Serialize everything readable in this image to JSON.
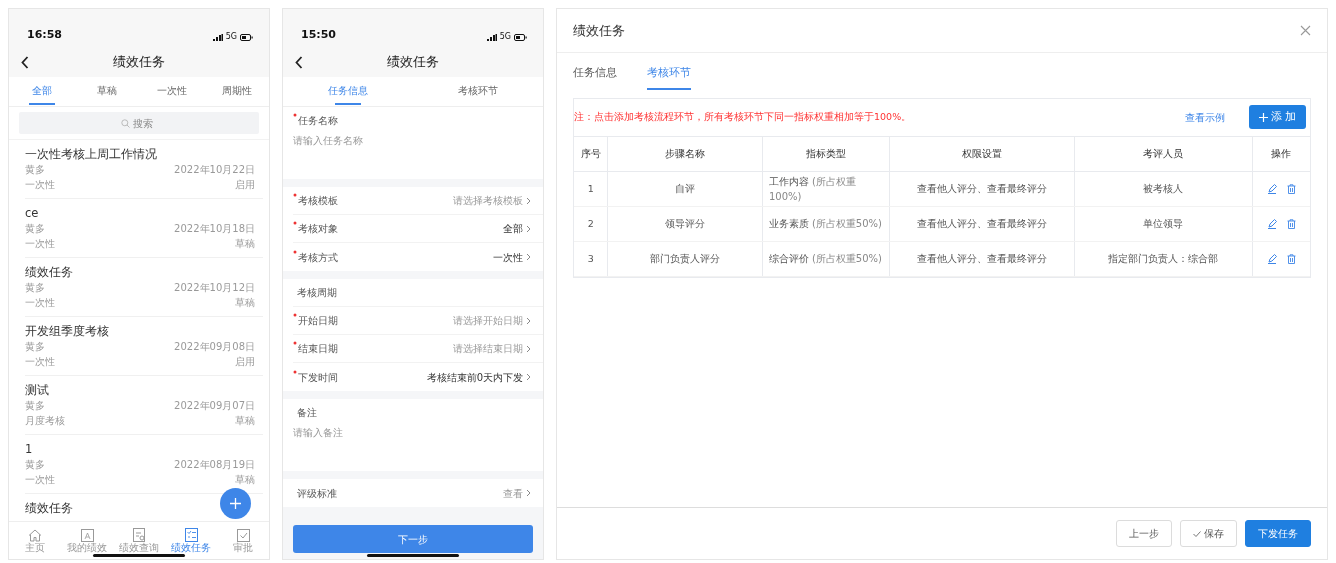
{
  "list_screen": {
    "status_time": "16:58",
    "network": "5G",
    "title": "绩效任务",
    "tabs": [
      {
        "label": "全部",
        "selected": true
      },
      {
        "label": "草稿",
        "selected": false
      },
      {
        "label": "一次性",
        "selected": false
      },
      {
        "label": "周期性",
        "selected": false
      }
    ],
    "search": {
      "placeholder": "搜索"
    },
    "items": [
      {
        "title": "一次性考核上周工作情况",
        "author": "黄多",
        "date": "2022年10月22日",
        "type": "一次性",
        "status": "启用"
      },
      {
        "title": "ce",
        "author": "黄多",
        "date": "2022年10月18日",
        "type": "一次性",
        "status": "草稿"
      },
      {
        "title": "绩效任务",
        "author": "黄多",
        "date": "2022年10月12日",
        "type": "一次性",
        "status": "草稿"
      },
      {
        "title": "开发组季度考核",
        "author": "黄多",
        "date": "2022年09月08日",
        "type": "一次性",
        "status": "启用"
      },
      {
        "title": "测试",
        "author": "黄多",
        "date": "2022年09月07日",
        "type": "月度考核",
        "status": "草稿"
      },
      {
        "title": "1",
        "author": "黄多",
        "date": "2022年08月19日",
        "type": "一次性",
        "status": "草稿"
      },
      {
        "title": "绩效任务"
      }
    ],
    "nav": [
      {
        "label": "主页",
        "selected": false
      },
      {
        "label": "我的绩效",
        "selected": false
      },
      {
        "label": "绩效查询",
        "selected": false
      },
      {
        "label": "绩效任务",
        "selected": true
      },
      {
        "label": "审批",
        "selected": false
      }
    ]
  },
  "form_screen": {
    "status_time": "15:50",
    "network": "5G",
    "title": "绩效任务",
    "tabs": [
      {
        "label": "任务信息",
        "selected": true
      },
      {
        "label": "考核环节",
        "selected": false
      }
    ],
    "sections": [
      {
        "fields": [
          {
            "kind": "textarea",
            "label": "任务名称",
            "required": true,
            "placeholder": "请输入任务名称"
          }
        ]
      },
      {
        "fields": [
          {
            "kind": "select",
            "label": "考核模板",
            "required": true,
            "placeholder": "请选择考核模板"
          },
          {
            "kind": "select",
            "label": "考核对象",
            "required": true,
            "value": "全部"
          },
          {
            "kind": "select",
            "label": "考核方式",
            "required": true,
            "value": "一次性"
          }
        ]
      },
      {
        "fields": [
          {
            "kind": "heading",
            "label": "考核周期",
            "required": false
          },
          {
            "kind": "select",
            "label": "开始日期",
            "required": true,
            "placeholder": "请选择开始日期"
          },
          {
            "kind": "select",
            "label": "结束日期",
            "required": true,
            "placeholder": "请选择结束日期"
          },
          {
            "kind": "select",
            "label": "下发时间",
            "required": true,
            "value": "考核结束前0天内下发"
          }
        ]
      },
      {
        "fields": [
          {
            "kind": "textarea",
            "label": "备注",
            "required": false,
            "placeholder": "请输入备注"
          }
        ]
      },
      {
        "fields": [
          {
            "kind": "select",
            "label": "评级标准",
            "required": false,
            "placeholder": "查看"
          }
        ]
      }
    ],
    "next_button": "下一步"
  },
  "dialog": {
    "title": "绩效任务",
    "tabs": [
      {
        "label": "任务信息",
        "selected": false
      },
      {
        "label": "考核环节",
        "selected": true
      }
    ],
    "note": "注：点击添加考核流程环节，所有考核环节下同一指标权重相加等于100%。",
    "example_link": "查看示例",
    "add_button": "添 加",
    "table": {
      "columns": [
        "序号",
        "步骤名称",
        "指标类型",
        "权限设置",
        "考评人员",
        "操作"
      ],
      "rows": [
        {
          "no": "1",
          "step": "自评",
          "indicator": "工作内容",
          "weight": "(所占权重100%)",
          "permission": "查看他人评分、查看最终评分",
          "reviewer": "被考核人"
        },
        {
          "no": "2",
          "step": "领导评分",
          "indicator": "业务素质",
          "weight": "(所占权重50%)",
          "permission": "查看他人评分、查看最终评分",
          "reviewer": "单位领导"
        },
        {
          "no": "3",
          "step": "部门负责人评分",
          "indicator": "综合评价",
          "weight": "(所占权重50%)",
          "permission": "查看他人评分、查看最终评分",
          "reviewer": "指定部门负责人：综合部"
        }
      ]
    },
    "footer_buttons": [
      {
        "label": "上一步",
        "kind": "default"
      },
      {
        "label": "保存",
        "kind": "check"
      },
      {
        "label": "下发任务",
        "kind": "primary"
      }
    ]
  }
}
